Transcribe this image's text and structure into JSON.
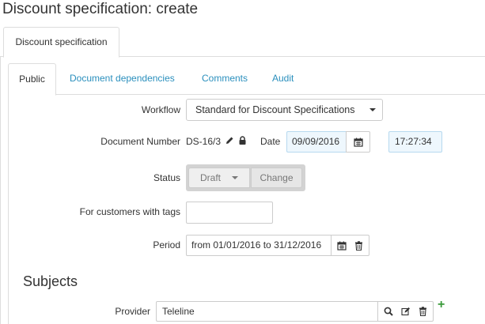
{
  "page": {
    "title": "Discount specification: create"
  },
  "outer_tabs": [
    {
      "label": "Discount specification"
    }
  ],
  "inner_tabs": [
    {
      "label": "Public"
    },
    {
      "label": "Document dependencies"
    },
    {
      "label": "Comments"
    },
    {
      "label": "Audit"
    }
  ],
  "form": {
    "workflow": {
      "label": "Workflow",
      "value": "Standard for Discount Specifications"
    },
    "document_number": {
      "label": "Document Number",
      "value": "DS-16/3"
    },
    "date": {
      "label": "Date",
      "value": "09/09/2016",
      "time": "17:27:34"
    },
    "status": {
      "label": "Status",
      "value": "Draft",
      "change_label": "Change"
    },
    "tags": {
      "label": "For customers with tags",
      "value": ""
    },
    "period": {
      "label": "Period",
      "value": "from 01/01/2016 to 31/12/2016"
    }
  },
  "subjects": {
    "title": "Subjects",
    "provider": {
      "label": "Provider",
      "value": "Teleline"
    },
    "add_symbol": "+"
  },
  "colors": {
    "link": "#2a8fbd",
    "add": "#3a9a3a",
    "highlight_input": "#eef7fd"
  }
}
